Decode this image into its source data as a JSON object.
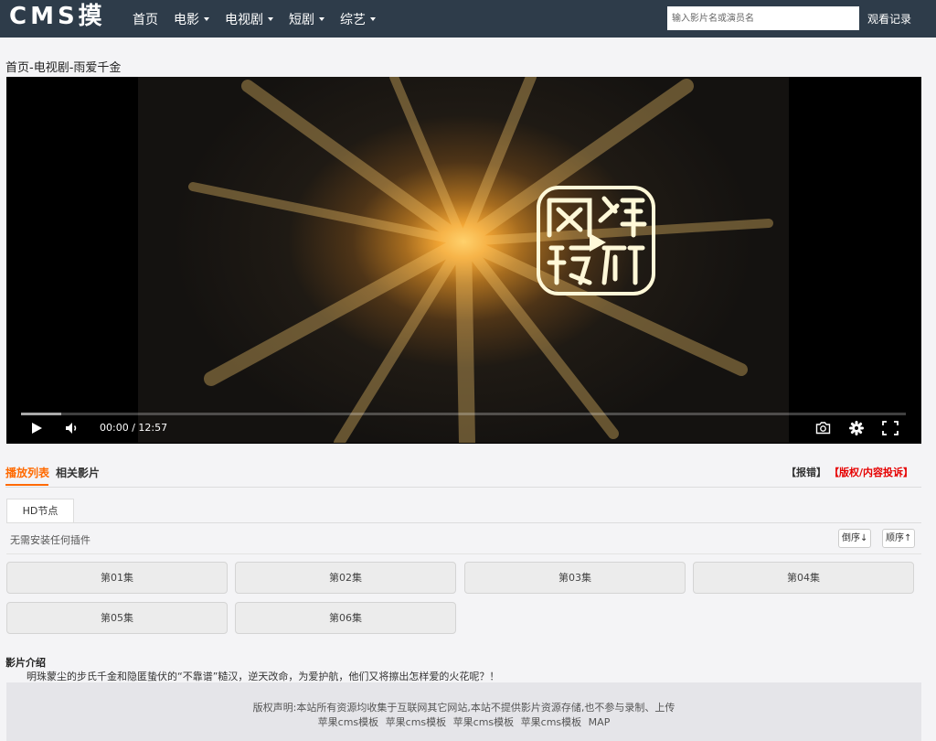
{
  "header": {
    "logo": "CMS摸",
    "nav": [
      {
        "label": "首页",
        "has_caret": false
      },
      {
        "label": "电影",
        "has_caret": true
      },
      {
        "label": "电视剧",
        "has_caret": true
      },
      {
        "label": "短剧",
        "has_caret": true
      },
      {
        "label": "综艺",
        "has_caret": true
      }
    ],
    "search_placeholder": "输入影片名或演员名",
    "history_label": "观看记录"
  },
  "breadcrumb": "首页-电视剧-雨爱千金",
  "player": {
    "time": "00:00 / 12:57",
    "progress": 0.045,
    "icons": [
      "play-icon",
      "volume-icon",
      "camera-icon",
      "gear-icon",
      "fullscreen-icon"
    ]
  },
  "tabs": {
    "playlist": "播放列表",
    "related": "相关影片",
    "report": "【报错】",
    "complaint": "【版权/内容投诉】"
  },
  "source": {
    "tab": "HD节点",
    "note": "无需安装任何插件",
    "sort_desc": "倒序↓",
    "sort_asc": "顺序↑"
  },
  "episodes": [
    "第01集",
    "第02集",
    "第03集",
    "第04集",
    "第05集",
    "第06集"
  ],
  "intro": {
    "title": "影片介绍",
    "text": "明珠蒙尘的步氏千金和隐匿蛰伏的“不靠谱”糙汉，逆天改命，为爱护航，他们又将擦出怎样爱的火花呢？！"
  },
  "footer": {
    "disclaimer": "版权声明:本站所有资源均收集于互联网其它网站,本站不提供影片资源存储,也不参与录制、上传",
    "links": [
      "苹果cms模板",
      "苹果cms模板",
      "苹果cms模板",
      "苹果cms模板",
      "MAP"
    ]
  },
  "colors": {
    "header_bg": "#2e3c4a",
    "accent": "#ff6a00",
    "complaint": "#e60000"
  }
}
